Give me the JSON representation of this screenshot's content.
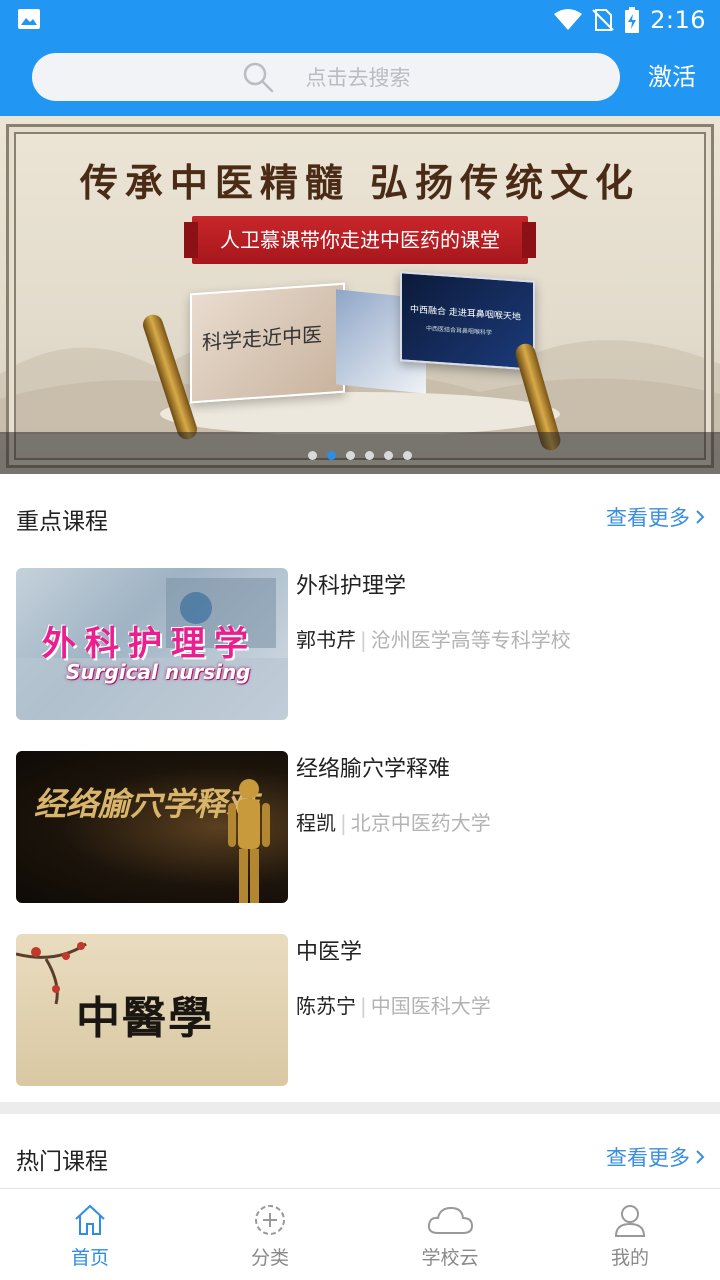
{
  "status_bar": {
    "time": "2:16"
  },
  "header": {
    "search_placeholder": "点击去搜索",
    "activate_label": "激活"
  },
  "banner": {
    "slogan": "传承中医精髓 弘扬传统文化",
    "ribbon": "人卫慕课带你走进中医药的课堂",
    "card_left_title": "科学走近中医",
    "card_right_title": "中西融合 走进耳鼻咽喉天地",
    "card_right_subtitle": "中西医结合耳鼻咽喉科学",
    "dots_total": 6,
    "active_dot": 2
  },
  "featured": {
    "title": "重点课程",
    "more_label": "查看更多",
    "courses": [
      {
        "title": "外科护理学",
        "teacher": "郭书芹",
        "school": "沧州医学高等专科学校",
        "thumb_text": "外科护理学",
        "thumb_subtext": "Surgical nursing"
      },
      {
        "title": "经络腧穴学释难",
        "teacher": "程凯",
        "school": "北京中医药大学",
        "thumb_text": "经络腧穴学释难"
      },
      {
        "title": "中医学",
        "teacher": "陈苏宁",
        "school": "中国医科大学",
        "thumb_text": "中醫學"
      }
    ]
  },
  "hot": {
    "title": "热门课程",
    "more_label": "查看更多"
  },
  "bottom_nav": [
    {
      "label": "首页",
      "icon": "home-icon",
      "active": true
    },
    {
      "label": "分类",
      "icon": "category-icon",
      "active": false
    },
    {
      "label": "学校云",
      "icon": "cloud-icon",
      "active": false
    },
    {
      "label": "我的",
      "icon": "user-icon",
      "active": false
    }
  ],
  "colors": {
    "primary": "#2196f3",
    "accent": "#2e8de6",
    "link": "#3a8ee0"
  }
}
